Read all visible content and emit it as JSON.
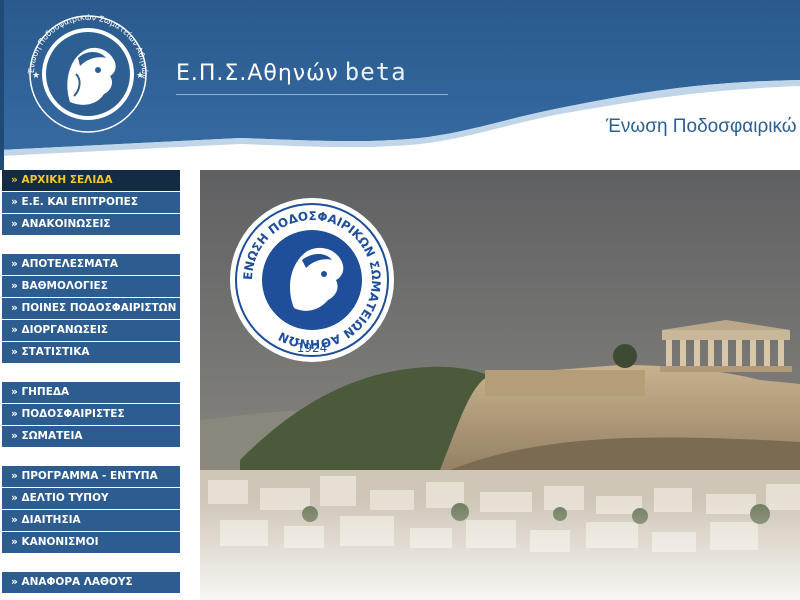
{
  "header": {
    "title": "Ε.Π.Σ.Αθηνών",
    "beta_label": "beta",
    "slogan": "Ένωση Ποδοσφαιρικώ",
    "logo_ring_text": "Ένωση Ποδοσφαιρικών Σωματείων Αθηνών",
    "colors": {
      "banner": "#2e5f92",
      "banner_dark": "#1f4a78"
    }
  },
  "sidebar": {
    "groups": [
      {
        "items": [
          {
            "label": "» ΑΡΧΙΚΗ ΣΕΛΙΔΑ",
            "active": true
          },
          {
            "label": "» Ε.Ε. ΚΑΙ ΕΠΙΤΡΟΠΕΣ",
            "active": false
          },
          {
            "label": "» ΑΝΑΚΟΙΝΩΣΕΙΣ",
            "active": false
          }
        ]
      },
      {
        "items": [
          {
            "label": "» ΑΠΟΤΕΛΕΣΜΑΤΑ",
            "active": false
          },
          {
            "label": "» ΒΑΘΜΟΛΟΓΙΕΣ",
            "active": false
          },
          {
            "label": "» ΠΟΙΝΕΣ ΠΟΔΟΣΦΑΙΡΙΣΤΩΝ",
            "active": false
          },
          {
            "label": "» ΔΙΟΡΓΑΝΩΣΕΙΣ",
            "active": false
          },
          {
            "label": "» ΣΤΑΤΙΣΤΙΚΑ",
            "active": false
          }
        ]
      },
      {
        "items": [
          {
            "label": "» ΓΗΠΕΔΑ",
            "active": false
          },
          {
            "label": "» ΠΟΔΟΣΦΑΙΡΙΣΤΕΣ",
            "active": false
          },
          {
            "label": "» ΣΩΜΑΤΕΙΑ",
            "active": false
          }
        ]
      },
      {
        "items": [
          {
            "label": "» ΠΡΟΓΡΑΜΜΑ - ΕΝΤΥΠΑ",
            "active": false
          },
          {
            "label": "» ΔΕΛΤΙΟ ΤΥΠΟΥ",
            "active": false
          },
          {
            "label": "» ΔΙΑΙΤΗΣΙΑ",
            "active": false
          },
          {
            "label": "» ΚΑΝΟΝΙΣΜΟΙ",
            "active": false
          }
        ]
      },
      {
        "items": [
          {
            "label": "» ΑΝΑΦΟΡΑ ΛΑΘΟΥΣ",
            "active": false
          }
        ]
      }
    ],
    "colors": {
      "item": "#2d5d90",
      "active_bg": "#142b44",
      "active_text": "#f2c531"
    }
  },
  "photo": {
    "seal_ring_text": "ΕΝΩΣΗ ΠΟΔΟΣΦΑΙΡΙΚΩΝ ΣΩΜΑΤΕΙΩΝ ΑΘΗΝΩΝ",
    "seal_year": "1924"
  }
}
